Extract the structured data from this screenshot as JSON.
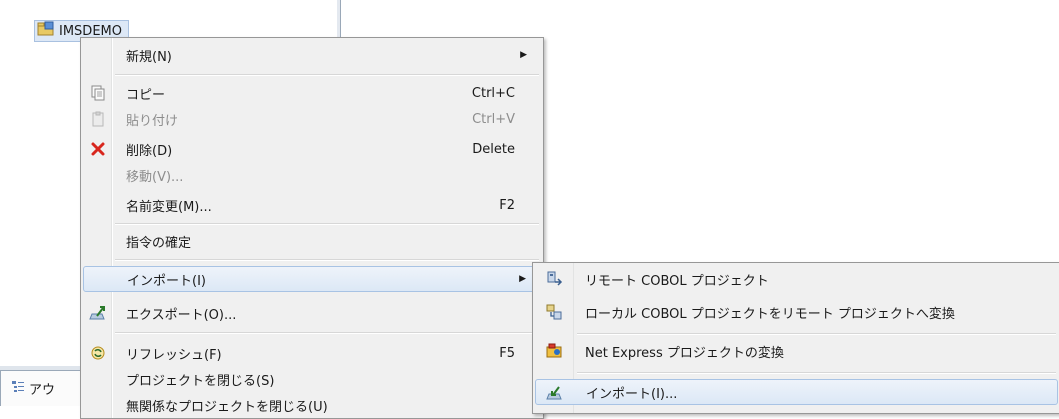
{
  "explorer": {
    "project_name": "IMSDEMO",
    "outline_tab": "アウ"
  },
  "context_menu": {
    "new": {
      "label": "新規(N)"
    },
    "copy": {
      "label": "コピー",
      "shortcut": "Ctrl+C"
    },
    "paste": {
      "label": "貼り付け",
      "shortcut": "Ctrl+V"
    },
    "delete": {
      "label": "削除(D)",
      "shortcut": "Delete"
    },
    "move": {
      "label": "移動(V)..."
    },
    "rename": {
      "label": "名前変更(M)...",
      "shortcut": "F2"
    },
    "directive": {
      "label": "指令の確定"
    },
    "import": {
      "label": "インポート(I)"
    },
    "export": {
      "label": "エクスポート(O)..."
    },
    "refresh": {
      "label": "リフレッシュ(F)",
      "shortcut": "F5"
    },
    "close_project": {
      "label": "プロジェクトを閉じる(S)"
    },
    "close_unrelated": {
      "label": "無関係なプロジェクトを閉じる(U)"
    }
  },
  "import_submenu": {
    "remote_cobol": {
      "label": "リモート COBOL プロジェクト"
    },
    "local_to_remote": {
      "label": "ローカル COBOL プロジェクトをリモート プロジェクトへ変換"
    },
    "net_express": {
      "label": "Net Express プロジェクトの変換"
    },
    "import_dots": {
      "label": "インポート(I)..."
    }
  },
  "colors": {
    "menu_bg": "#f0f0f0",
    "highlight_border": "#a8c3e4",
    "disabled_text": "#8d8d8d",
    "delete_icon": "#d8261d"
  }
}
